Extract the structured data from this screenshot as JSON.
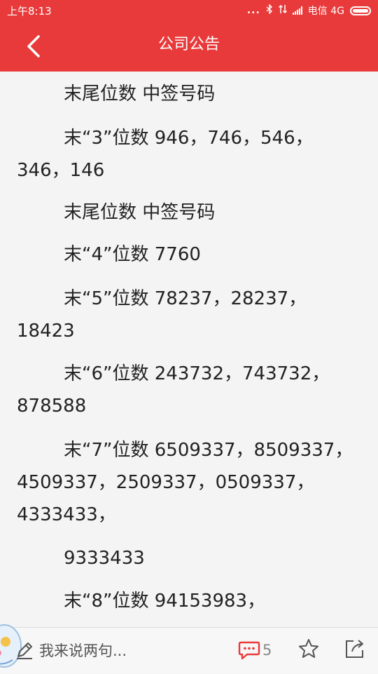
{
  "status_bar": {
    "time": "上午8:13",
    "carrier": "电信 4G",
    "dots": "...",
    "icons": [
      "bluetooth-icon",
      "data-transfer-icon",
      "signal-icon",
      "battery-icon"
    ]
  },
  "header": {
    "title": "公司公告",
    "back_icon": "chevron-left-icon",
    "background": "#e83a3a"
  },
  "article": {
    "paragraphs": [
      "末尾位数 中签号码",
      "末“3”位数 946，746，546，346，146",
      "末尾位数 中签号码",
      "末“4”位数 7760",
      "末“5”位数 78237，28237，18423",
      "末“6”位数 243732，743732，878588",
      "末“7”位数 6509337，8509337，4509337，2509337，0509337，4333433，",
      "9333433",
      "末“8”位数 94153983，"
    ]
  },
  "bottom_bar": {
    "comment_placeholder": "我来说两句...",
    "comment_count": "5",
    "icons": [
      "pencil-icon",
      "comment-bubble-icon",
      "star-icon",
      "share-icon"
    ],
    "accent": "#e83a3a"
  }
}
